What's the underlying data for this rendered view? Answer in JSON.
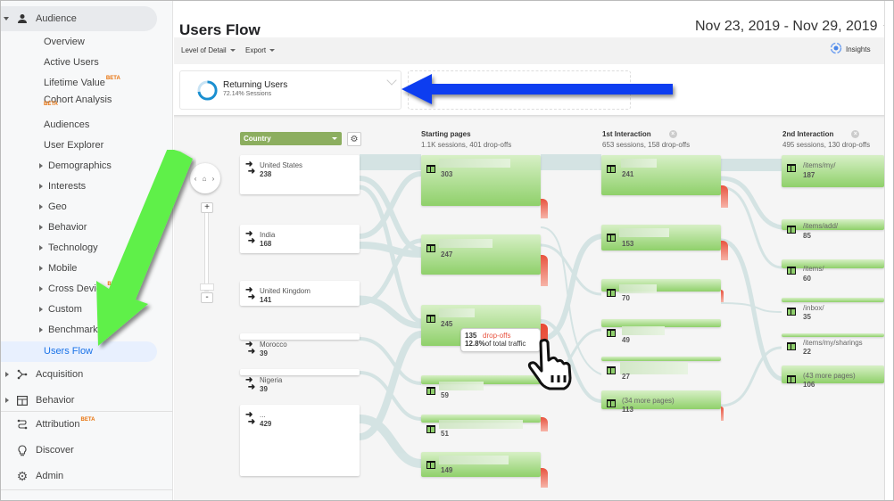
{
  "sidebar": {
    "audience": "Audience",
    "items": [
      {
        "label": "Overview"
      },
      {
        "label": "Active Users"
      },
      {
        "label": "Lifetime Value",
        "badge": "BETA"
      },
      {
        "label": "Cohort Analysis",
        "badge": "BETA"
      },
      {
        "label": "Audiences"
      },
      {
        "label": "User Explorer"
      },
      {
        "label": "Demographics"
      },
      {
        "label": "Interests"
      },
      {
        "label": "Geo"
      },
      {
        "label": "Behavior"
      },
      {
        "label": "Technology"
      },
      {
        "label": "Mobile"
      },
      {
        "label": "Cross Device",
        "badge": "BETA"
      },
      {
        "label": "Custom"
      },
      {
        "label": "Benchmarking"
      },
      {
        "label": "Users Flow"
      }
    ],
    "sections": [
      {
        "label": "Acquisition"
      },
      {
        "label": "Behavior"
      },
      {
        "label": "Attribution",
        "badge": "BETA"
      },
      {
        "label": "Discover"
      },
      {
        "label": "Admin"
      }
    ]
  },
  "header": {
    "title": "Users Flow",
    "date_range": "Nov 23, 2019 - Nov 29, 2019",
    "level_of_detail": "Level of Detail",
    "export": "Export",
    "insights": "Insights"
  },
  "segment": {
    "name": "Returning Users",
    "sub": "72.14% Sessions",
    "percent": 72.14
  },
  "flow": {
    "dimension": "Country",
    "countries": [
      {
        "name": "United States",
        "value": "238"
      },
      {
        "name": "India",
        "value": "168"
      },
      {
        "name": "United Kingdom",
        "value": "141"
      },
      {
        "name": "Morocco",
        "value": "39"
      },
      {
        "name": "Nigeria",
        "value": "39"
      },
      {
        "name": "...",
        "value": "429"
      }
    ],
    "columns": [
      {
        "title": "Starting pages",
        "stats": "1.1K sessions, 401 drop-offs",
        "nodes": [
          {
            "label": "",
            "value": "303"
          },
          {
            "label": "",
            "value": "247"
          },
          {
            "label": "",
            "value": "245"
          },
          {
            "label": "",
            "value": "59"
          },
          {
            "label": "",
            "value": "51"
          },
          {
            "label": "",
            "value": "149"
          }
        ]
      },
      {
        "title": "1st Interaction",
        "stats": "653 sessions, 158 drop-offs",
        "nodes": [
          {
            "label": "",
            "value": "241"
          },
          {
            "label": "",
            "value": "153"
          },
          {
            "label": "",
            "value": "70"
          },
          {
            "label": "",
            "value": "49"
          },
          {
            "label": "",
            "value": "27"
          },
          {
            "label": "(34 more pages)",
            "value": "113"
          }
        ]
      },
      {
        "title": "2nd Interaction",
        "stats": "495 sessions, 130 drop-offs",
        "nodes": [
          {
            "label": "/items/my/",
            "value": "187"
          },
          {
            "label": "/items/add/",
            "value": "85"
          },
          {
            "label": "/items/",
            "value": "60"
          },
          {
            "label": "/inbox/",
            "value": "35"
          },
          {
            "label": "/items/my/sharings",
            "value": "22"
          },
          {
            "label": "(43 more pages)",
            "value": "106"
          }
        ]
      }
    ],
    "tooltip": {
      "count": "135",
      "label": "drop-offs",
      "pct": "12.8%",
      "pct_label": "of total traffic"
    }
  },
  "annotations": {
    "blue_arrow_color": "#0a3cf0",
    "green_arrow_color": "#5ef04a"
  }
}
